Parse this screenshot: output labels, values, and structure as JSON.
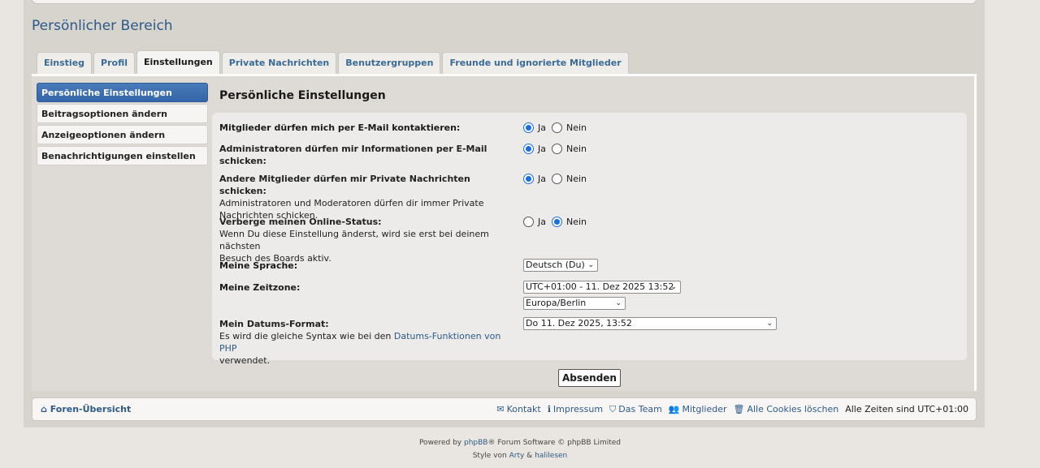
{
  "page_title": "Persönlicher Bereich",
  "tabs": [
    "Einstieg",
    "Profil",
    "Einstellungen",
    "Private Nachrichten",
    "Benutzergruppen",
    "Freunde und ignorierte Mitglieder"
  ],
  "sidebar": [
    {
      "label": "Persönliche Einstellungen",
      "active": true
    },
    {
      "label": "Beitragsoptionen ändern"
    },
    {
      "label": "Anzeigeoptionen ändern"
    },
    {
      "label": "Benachrichtigungen einstellen"
    }
  ],
  "content_title": "Persönliche Einstellungen",
  "settings": {
    "email": {
      "label": "Mitglieder dürfen mich per E-Mail kontaktieren:",
      "selected": "Ja"
    },
    "admin": {
      "label1": "Administratoren dürfen mir Informationen per E-Mail",
      "label2": "schicken:",
      "selected": "Ja"
    },
    "pm": {
      "label": "Andere Mitglieder dürfen mir Private Nachrichten schicken:",
      "desc1": "Administratoren und Moderatoren dürfen dir immer Private",
      "desc2": "Nachrichten schicken.",
      "selected": "Ja"
    },
    "online": {
      "label": "Verberge meinen Online-Status:",
      "desc1": "Wenn Du diese Einstellung änderst, wird sie erst bei deinem nächsten",
      "desc2": "Besuch des Boards aktiv.",
      "selected": "Nein"
    },
    "language": {
      "label": "Meine Sprache:",
      "value": "Deutsch (Du)"
    },
    "timezone": {
      "label": "Meine Zeitzone:",
      "value": "UTC+01:00 - 11. Dez 2025 13:52",
      "zone": "Europa/Berlin"
    },
    "dateformat": {
      "label": "Mein Datums-Format:",
      "desc_pre": "Es wird die gleiche Syntax wie bei den ",
      "desc_link": "Datums-Funktionen von PHP",
      "desc_post": "verwendet.",
      "value": "Do 11. Dez 2025, 13:52"
    }
  },
  "options": {
    "yes": "Ja",
    "no": "Nein"
  },
  "submit_label": "Absenden",
  "footer": {
    "home": "Foren-Übersicht",
    "links": [
      {
        "icon": "envelope-icon",
        "glyph": "✉",
        "label": "Kontakt"
      },
      {
        "icon": "info-icon",
        "glyph": "ℹ",
        "label": "Impressum"
      },
      {
        "icon": "shield-icon",
        "glyph": "⛉",
        "label": "Das Team"
      },
      {
        "icon": "users-icon",
        "glyph": "👥",
        "label": "Mitglieder"
      },
      {
        "icon": "trash-icon",
        "glyph": "🗑",
        "label": "Alle Cookies löschen"
      }
    ],
    "timezone_note": "Alle Zeiten sind UTC+01:00"
  },
  "credits": {
    "powered_pre": "Powered by ",
    "powered_link": "phpBB",
    "powered_post": "® Forum Software © phpBB Limited",
    "style_pre": "Style von ",
    "style_link1": "Arty",
    "style_amp": " & ",
    "style_link2": "halilesen"
  }
}
